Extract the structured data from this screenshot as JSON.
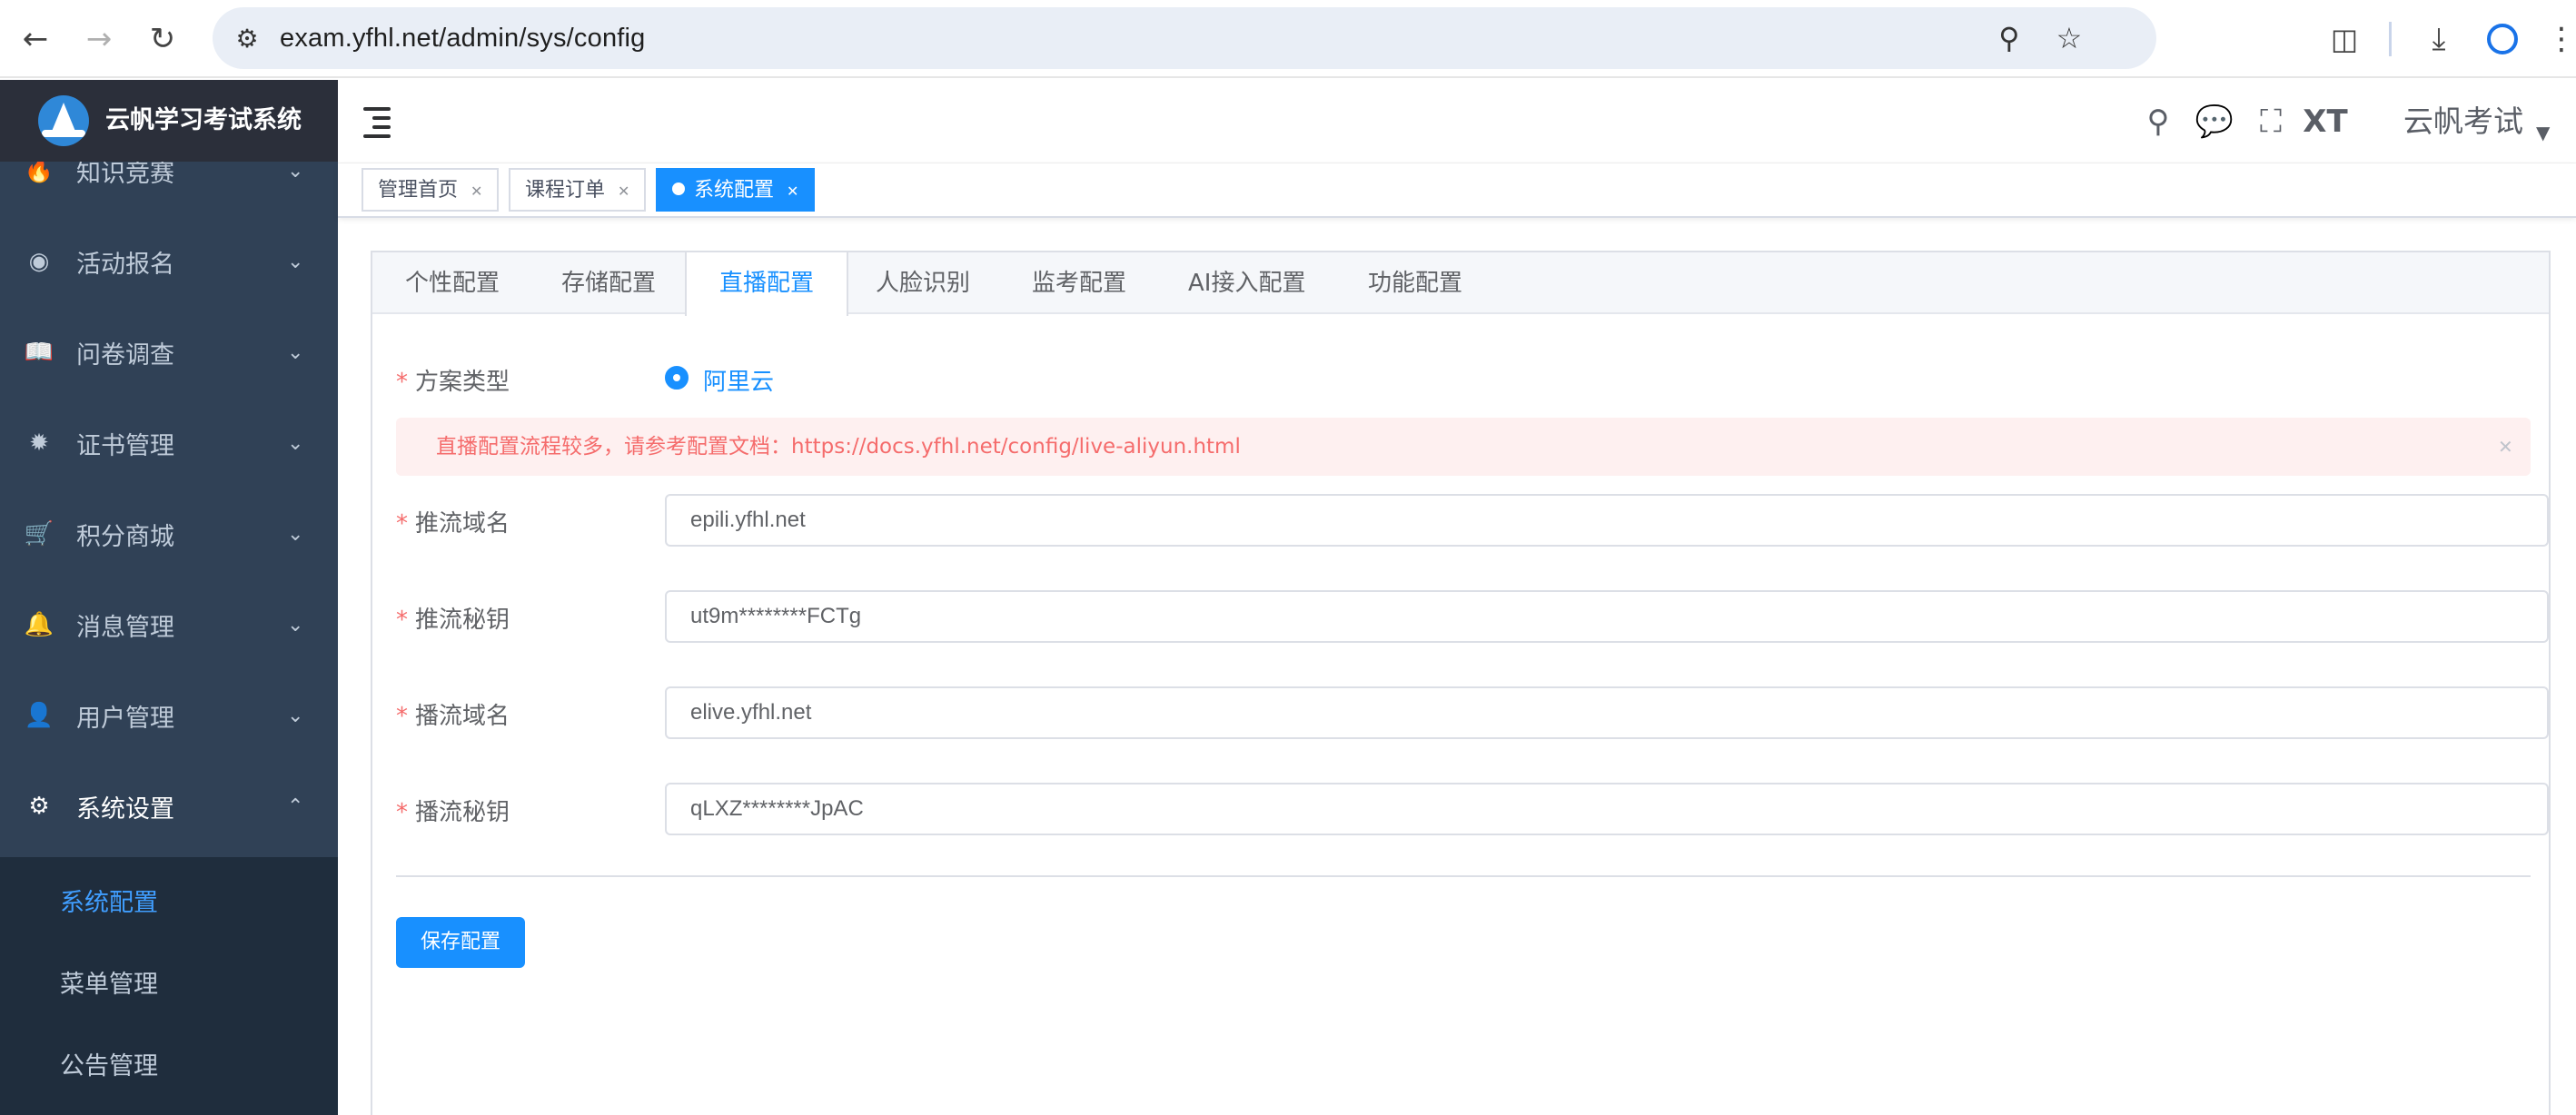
{
  "browser": {
    "url": "exam.yfhl.net/admin/sys/config"
  },
  "sidebar": {
    "logo_title": "云帆学习考试系统",
    "items": [
      {
        "label": "知识竞赛",
        "icon": "fire-icon"
      },
      {
        "label": "活动报名",
        "icon": "activity-icon"
      },
      {
        "label": "问卷调查",
        "icon": "book-icon"
      },
      {
        "label": "证书管理",
        "icon": "certificate-icon"
      },
      {
        "label": "积分商城",
        "icon": "cart-icon"
      },
      {
        "label": "消息管理",
        "icon": "bell-icon"
      },
      {
        "label": "用户管理",
        "icon": "user-icon"
      },
      {
        "label": "系统设置",
        "icon": "gear-icon"
      }
    ],
    "submenu": [
      {
        "label": "系统配置",
        "active": true
      },
      {
        "label": "菜单管理",
        "active": false
      },
      {
        "label": "公告管理",
        "active": false
      }
    ]
  },
  "navbar": {
    "user_name": "云帆考试"
  },
  "tags": [
    {
      "label": "管理首页",
      "active": false
    },
    {
      "label": "课程订单",
      "active": false
    },
    {
      "label": "系统配置",
      "active": true
    }
  ],
  "tabs": [
    {
      "label": "个性配置",
      "active": false
    },
    {
      "label": "存储配置",
      "active": false
    },
    {
      "label": "直播配置",
      "active": true
    },
    {
      "label": "人脸识别",
      "active": false
    },
    {
      "label": "监考配置",
      "active": false
    },
    {
      "label": "AI接入配置",
      "active": false
    },
    {
      "label": "功能配置",
      "active": false
    }
  ],
  "form": {
    "scheme_label": "方案类型",
    "scheme_option": "阿里云",
    "alert_text": "直播配置流程较多，请参考配置文档：https://docs.yfhl.net/config/live-aliyun.html",
    "fields": [
      {
        "label": "推流域名",
        "value": "epili.yfhl.net"
      },
      {
        "label": "推流秘钥",
        "value": "ut9m********FCTg"
      },
      {
        "label": "播流域名",
        "value": "elive.yfhl.net"
      },
      {
        "label": "播流秘钥",
        "value": "qLXZ********JpAC"
      }
    ],
    "required_mark": "*",
    "save_label": "保存配置"
  },
  "colors": {
    "sidebar_bg": "#304156",
    "submenu_bg": "#1f2d3d",
    "primary": "#1890ff",
    "danger": "#f56c6c",
    "alert_bg": "#fef0f0"
  }
}
